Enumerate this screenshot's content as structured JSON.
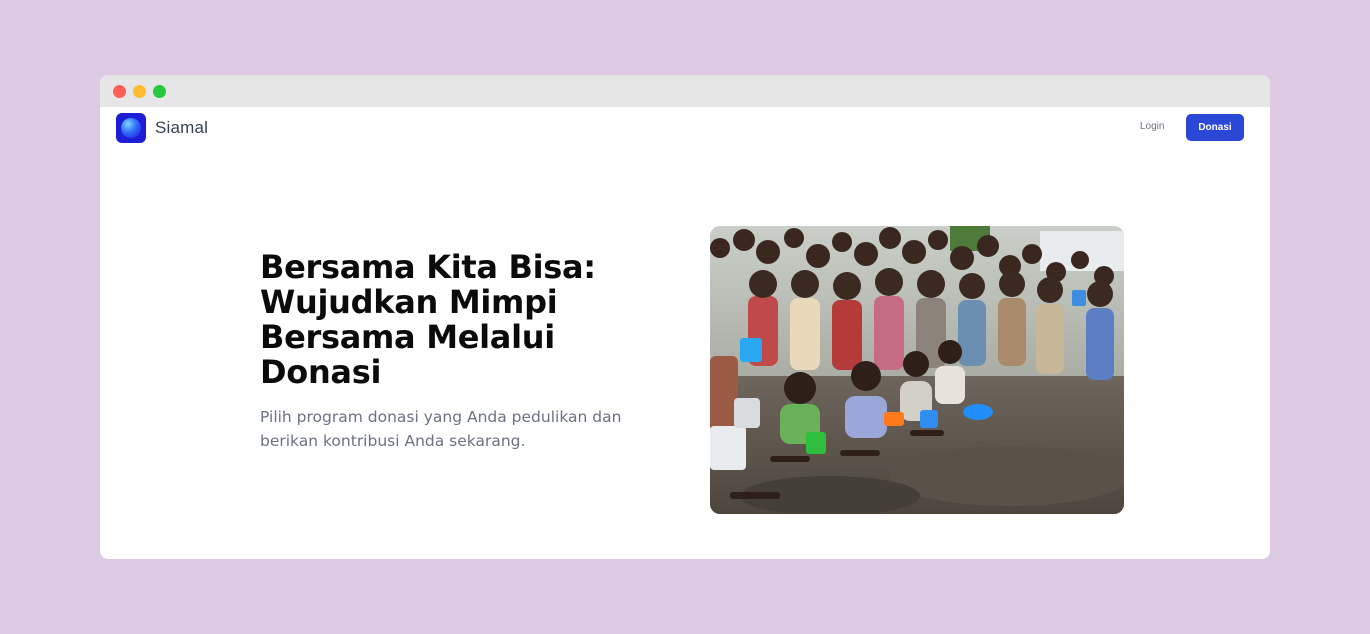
{
  "window": {
    "controls": [
      "close",
      "minimize",
      "maximize"
    ]
  },
  "navbar": {
    "brand": "Siamal",
    "logo_icon": "blue-orb-logo-icon",
    "login_label": "Login",
    "donasi_label": "Donasi",
    "accent_color": "#2b47d6"
  },
  "hero": {
    "title": "Bersama Kita Bisa: Wujudkan Mimpi Bersama Melalui Donasi",
    "subtitle": "Pilih program donasi yang Anda pedulikan dan berikan kontribusi Anda sekarang."
  }
}
